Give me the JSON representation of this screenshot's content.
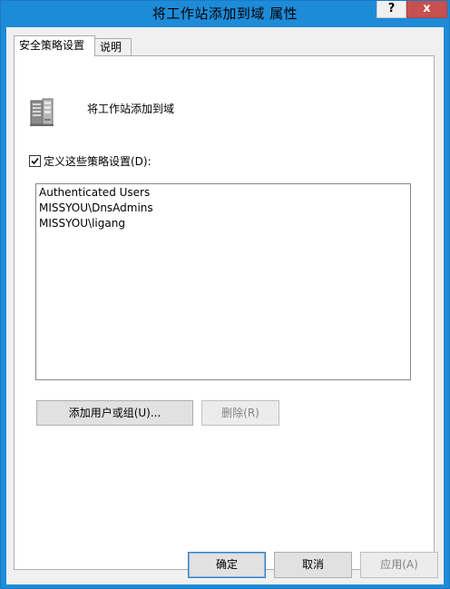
{
  "window": {
    "title": "将工作站添加到域 属性",
    "help_label": "?",
    "close_label": "x"
  },
  "tabs": [
    {
      "label": "安全策略设置",
      "active": true
    },
    {
      "label": "说明",
      "active": false
    }
  ],
  "policy": {
    "icon": "server-computer-icon",
    "name": "将工作站添加到域"
  },
  "define_setting": {
    "checked": true,
    "label": "定义这些策略设置(D):"
  },
  "principals": [
    "Authenticated Users",
    "MISSYOU\\DnsAdmins",
    "MISSYOU\\ligang"
  ],
  "buttons": {
    "add": "添加用户或组(U)...",
    "remove": "删除(R)",
    "ok": "确定",
    "cancel": "取消",
    "apply": "应用(A)"
  },
  "colors": {
    "titlebar": "#1e8bd8",
    "close": "#c75050",
    "client": "#f0f0f0"
  }
}
